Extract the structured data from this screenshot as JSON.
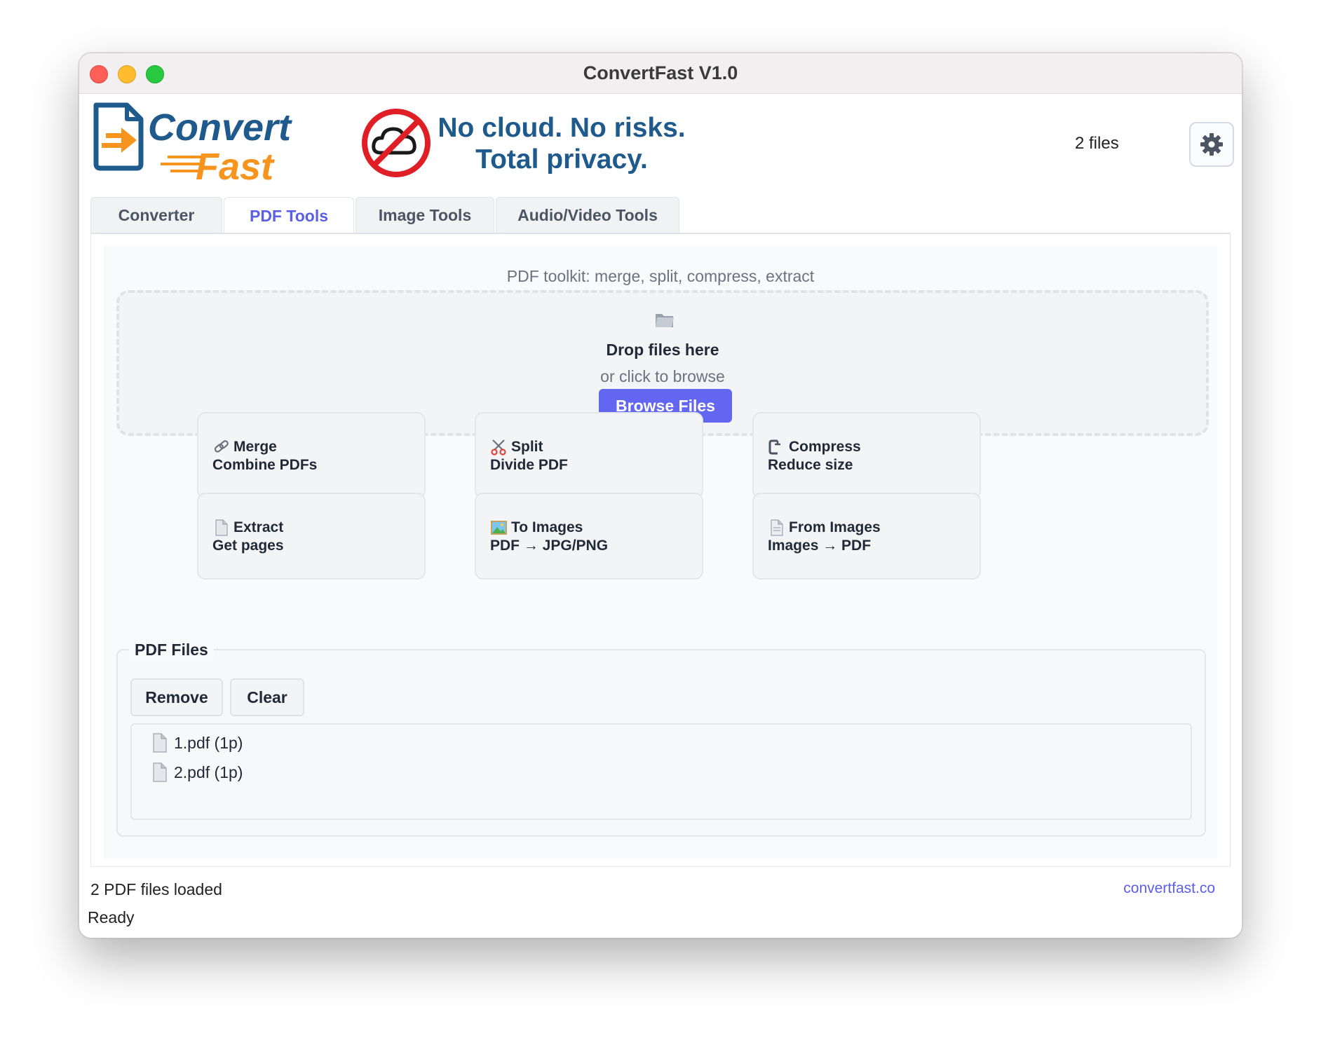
{
  "window": {
    "title": "ConvertFast V1.0"
  },
  "header": {
    "logo_word1": "Convert",
    "logo_word2": "Fast",
    "privacy_line1": "No cloud. No risks.",
    "privacy_line2": "Total privacy.",
    "file_count": "2 files"
  },
  "tabs": [
    {
      "label": "Converter",
      "active": false
    },
    {
      "label": "PDF Tools",
      "active": true
    },
    {
      "label": "Image Tools",
      "active": false
    },
    {
      "label": "Audio/Video Tools",
      "active": false
    }
  ],
  "pdf_tools": {
    "subtitle": "PDF toolkit: merge, split, compress, extract",
    "dropzone": {
      "icon": "folder-icon",
      "title": "Drop files here",
      "subtitle": "or click to browse",
      "button": "Browse Files"
    },
    "tools": [
      {
        "icon": "link-icon",
        "name": "Merge",
        "desc": "Combine PDFs"
      },
      {
        "icon": "scissors-icon",
        "name": "Split",
        "desc": "Divide PDF"
      },
      {
        "icon": "clamp-icon",
        "name": "Compress",
        "desc": "Reduce size"
      },
      {
        "icon": "page-icon",
        "name": "Extract",
        "desc": "Get pages"
      },
      {
        "icon": "picture-icon",
        "name": "To Images",
        "desc": "PDF → JPG/PNG"
      },
      {
        "icon": "page-curl-icon",
        "name": "From Images",
        "desc": "Images → PDF"
      }
    ],
    "files_group": {
      "title": "PDF Files",
      "remove_label": "Remove",
      "clear_label": "Clear",
      "files": [
        "1.pdf (1p)",
        "2.pdf (1p)"
      ]
    }
  },
  "status": {
    "message": "2 PDF files loaded",
    "link": "convertfast.co",
    "state": "Ready"
  },
  "colors": {
    "accent": "#6366f1",
    "brand_blue": "#1f5a8c",
    "brand_orange": "#f7941d",
    "no_sign_red": "#e01e26"
  }
}
